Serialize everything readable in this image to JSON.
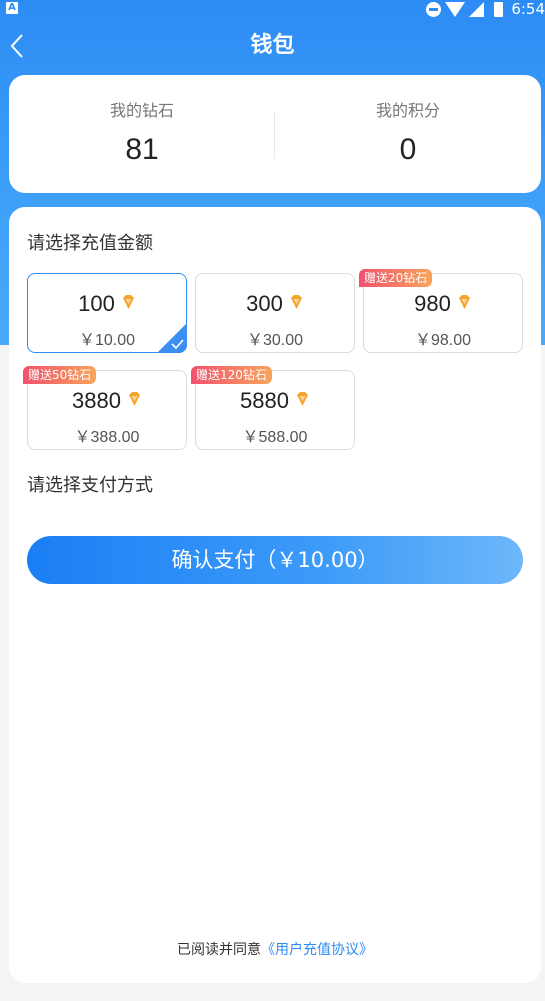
{
  "status_bar": {
    "app_badge": "A",
    "time": "6:54"
  },
  "nav": {
    "title": "钱包"
  },
  "balance": {
    "diamonds_label": "我的钻石",
    "diamonds_value": "81",
    "points_label": "我的积分",
    "points_value": "0"
  },
  "recharge": {
    "section_title": "请选择充值金额",
    "packages": [
      {
        "amount": "100",
        "price": "￥10.00",
        "badge": "",
        "selected": true
      },
      {
        "amount": "300",
        "price": "￥30.00",
        "badge": "",
        "selected": false
      },
      {
        "amount": "980",
        "price": "￥98.00",
        "badge": "赠送20钻石",
        "selected": false
      },
      {
        "amount": "3880",
        "price": "￥388.00",
        "badge": "赠送50钻石",
        "selected": false
      },
      {
        "amount": "5880",
        "price": "￥588.00",
        "badge": "赠送120钻石",
        "selected": false
      }
    ]
  },
  "payment": {
    "section_title": "请选择支付方式"
  },
  "confirm_button": {
    "label": "确认支付（￥10.00）"
  },
  "agreement": {
    "text": "已阅读并同意",
    "link": "《用户充值协议》"
  },
  "colors": {
    "primary": "#2d8cf4",
    "diamond": "#f7a42b",
    "badge_start": "#f2516e",
    "badge_end": "#f7a55a"
  }
}
